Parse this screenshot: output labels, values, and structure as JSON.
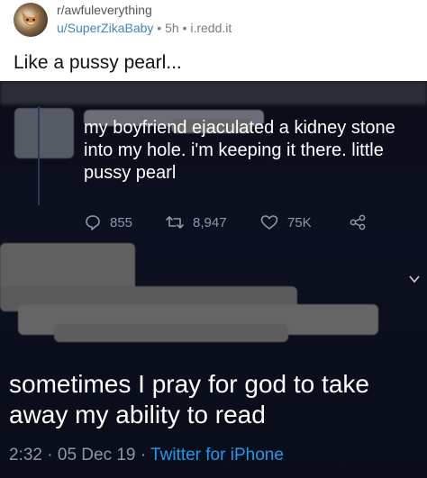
{
  "post": {
    "subreddit": "r/awfuleverything",
    "username": "u/SuperZikaBaby",
    "age": "5h",
    "domain": "i.redd.it",
    "separator": "•",
    "title": "Like a pussy pearl..."
  },
  "tweet": {
    "text": "my boyfriend ejaculated a kidney stone into my hole. i'm keeping it there. little pussy pearl",
    "replies": "855",
    "retweets": "8,947",
    "likes": "75K"
  },
  "reply_tweet": {
    "text": "sometimes I pray for god to take away my ability to read",
    "time": "2:32",
    "date": "05 Dec 19",
    "source": "Twitter for iPhone",
    "dot": "·"
  },
  "icons": {
    "reply": "speech-bubble-icon",
    "retweet": "retweet-icon",
    "like": "heart-icon",
    "share": "share-icon",
    "chevron": "chevron-down-icon"
  },
  "colors": {
    "username": "#3e86b8",
    "twitter_blue": "#1d9bf0",
    "muted": "#8b98a5",
    "background_dark": "#0a0c14"
  }
}
